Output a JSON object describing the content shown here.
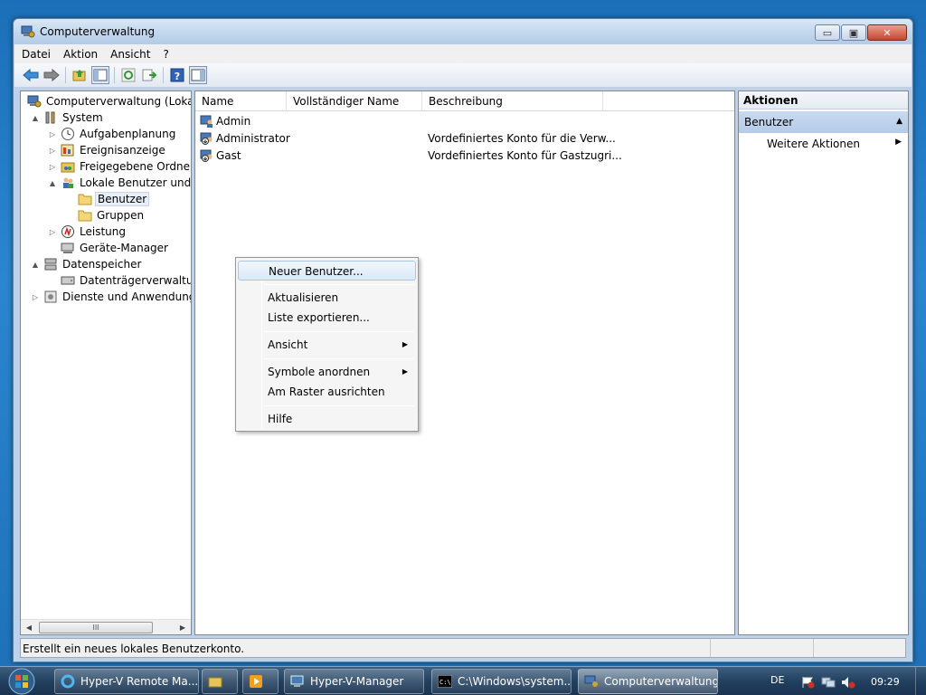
{
  "window": {
    "title": "Computerverwaltung",
    "buttons": {
      "minimize": "▭",
      "maximize": "▣",
      "close": "✕"
    }
  },
  "menu": [
    "Datei",
    "Aktion",
    "Ansicht",
    "?"
  ],
  "tree": [
    {
      "label": "Computerverwaltung (Lokal)",
      "icon": "computer-management-icon",
      "level": 0,
      "expander": ""
    },
    {
      "label": "System",
      "icon": "tools-icon",
      "level": 1,
      "expander": "▲"
    },
    {
      "label": "Aufgabenplanung",
      "icon": "clock-icon",
      "level": 2,
      "expander": "▷"
    },
    {
      "label": "Ereignisanzeige",
      "icon": "event-viewer-icon",
      "level": 2,
      "expander": "▷"
    },
    {
      "label": "Freigegebene Ordner",
      "icon": "shared-folder-icon",
      "level": 2,
      "expander": "▷"
    },
    {
      "label": "Lokale Benutzer und Gr",
      "icon": "users-icon",
      "level": 2,
      "expander": "▲"
    },
    {
      "label": "Benutzer",
      "icon": "folder-icon",
      "level": 3,
      "expander": "",
      "selected": true
    },
    {
      "label": "Gruppen",
      "icon": "folder-icon",
      "level": 3,
      "expander": ""
    },
    {
      "label": "Leistung",
      "icon": "performance-icon",
      "level": 2,
      "expander": "▷"
    },
    {
      "label": "Geräte-Manager",
      "icon": "device-manager-icon",
      "level": 2,
      "expander": ""
    },
    {
      "label": "Datenspeicher",
      "icon": "storage-icon",
      "level": 1,
      "expander": "▲"
    },
    {
      "label": "Datenträgerverwaltung",
      "icon": "disk-icon",
      "level": 2,
      "expander": ""
    },
    {
      "label": "Dienste und Anwendungen",
      "icon": "services-icon",
      "level": 1,
      "expander": "▷"
    }
  ],
  "list": {
    "columns": [
      "Name",
      "Vollständiger Name",
      "Beschreibung"
    ],
    "rows": [
      {
        "name": "Admin",
        "fullname": "",
        "description": ""
      },
      {
        "name": "Administrator",
        "fullname": "",
        "description": "Vordefiniertes Konto für die Verw..."
      },
      {
        "name": "Gast",
        "fullname": "",
        "description": "Vordefiniertes Konto für Gastzugri..."
      }
    ]
  },
  "actions": {
    "header": "Aktionen",
    "section": "Benutzer",
    "item": "Weitere Aktionen"
  },
  "context_menu": {
    "items": [
      "Neuer Benutzer...",
      "Aktualisieren",
      "Liste exportieren...",
      "Ansicht",
      "Symbole anordnen",
      "Am Raster ausrichten",
      "Hilfe"
    ]
  },
  "scrollbar": {
    "thumb_grip": "III"
  },
  "status": "Erstellt ein neues lokales Benutzerkonto.",
  "taskbar": {
    "buttons": [
      "Hyper-V Remote Ma...",
      "",
      "",
      "Hyper-V-Manager",
      "C:\\Windows\\system...",
      "Computerverwaltung"
    ],
    "language": "DE",
    "clock": "09:29"
  }
}
